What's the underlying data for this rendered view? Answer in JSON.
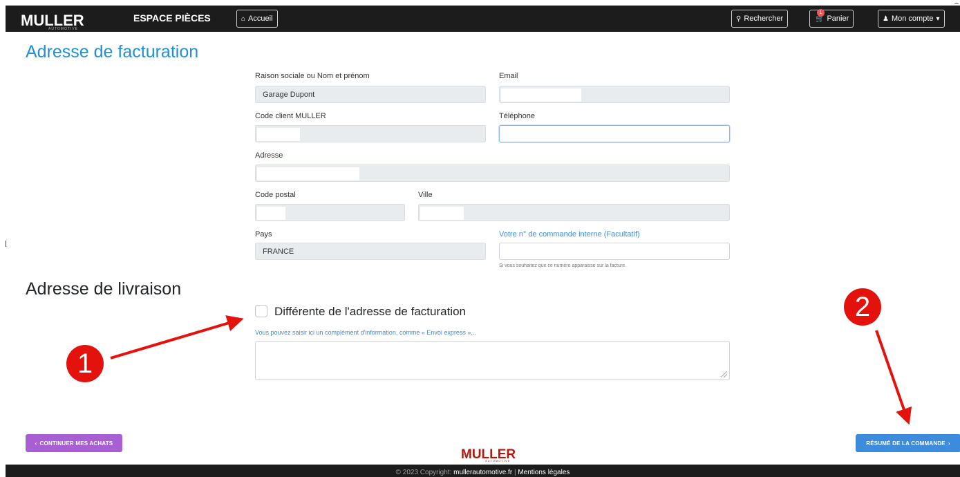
{
  "navbar": {
    "brand": "MULLER",
    "brand_sub": "AUTOMOTIVE",
    "section_title": "ESPACE PIÈCES",
    "home_label": "Accueil",
    "search_label": "Rechercher",
    "cart_label": "Panier",
    "cart_count": "1",
    "account_label": "Mon compte"
  },
  "billing": {
    "heading": "Adresse de facturation",
    "company_label": "Raison sociale ou Nom et prénom",
    "company_value": "Garage Dupont",
    "email_label": "Email",
    "email_value": "",
    "client_code_label": "Code client MULLER",
    "client_code_value": "",
    "phone_label": "Téléphone",
    "phone_value": "",
    "address_label": "Adresse",
    "address_value": "",
    "postal_label": "Code postal",
    "postal_value": "",
    "city_label": "Ville",
    "city_value": "",
    "country_label": "Pays",
    "country_value": "FRANCE",
    "order_ref_label": "Votre n° de commande interne (Facultatif)",
    "order_ref_value": "",
    "order_ref_help": "Si vous souhaitez que ce numéro apparaisse sur la facture."
  },
  "delivery": {
    "heading": "Adresse de livraison",
    "different_checkbox_label": "Différente de l'adresse de facturation",
    "different_checked": false,
    "note_hint": "Vous pouvez saisir ici un complément d'information, comme « Envoi express »...",
    "note_value": ""
  },
  "annotations": {
    "marker_1": "1",
    "marker_2": "2",
    "color": "#e4120c"
  },
  "actions": {
    "continue_label": "CONTINUER MES ACHATS",
    "continue_icon": "chevron-left-icon",
    "resume_label": "RÉSUMÉ DE LA COMMANDE",
    "resume_icon": "chevron-right-icon"
  },
  "footer": {
    "logo": "MULLER",
    "logo_sub": "AUTOMOTIVE",
    "copyright": "© 2023 Copyright:",
    "site": "mullerautomotive.fr",
    "separator": "|",
    "legal": "Mentions légales"
  },
  "colors": {
    "heading_blue": "#1f8fd6",
    "navbar": "#1c1c1c",
    "continue_button": "#a85fd4",
    "resume_button": "#3d8bdd"
  }
}
